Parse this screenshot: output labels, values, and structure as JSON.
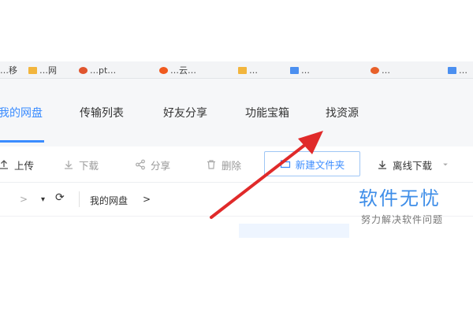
{
  "bookmarks": [
    {
      "label": "…移",
      "color": "#e7a23a"
    },
    {
      "label": "…网",
      "color": "#f2b53d"
    },
    {
      "label": "…pt…",
      "color": "#e0552e"
    },
    {
      "label": "…云…",
      "color": "#f05a1f"
    },
    {
      "label": "…",
      "color": "#f2b53d"
    },
    {
      "label": "…",
      "color": "#4b8ff0"
    },
    {
      "label": "…",
      "color": "#e8602a"
    },
    {
      "label": "…",
      "color": "#4b8ff0"
    }
  ],
  "tabs": [
    {
      "label": "我的网盘",
      "active": true
    },
    {
      "label": "传输列表",
      "active": false
    },
    {
      "label": "好友分享",
      "active": false
    },
    {
      "label": "功能宝箱",
      "active": false
    },
    {
      "label": "找资源",
      "active": false
    }
  ],
  "toolbar": {
    "upload": "上传",
    "download": "下载",
    "share": "分享",
    "delete": "删除",
    "new_folder": "新建文件夹",
    "offline_download": "离线下载"
  },
  "path": {
    "forward": ">",
    "dropdown": "▾",
    "refresh": "⟳",
    "current": "我的网盘",
    "trail_arrow": ">"
  },
  "watermark": {
    "title": "软件无忧",
    "subtitle": "努力解决软件问题"
  },
  "colors": {
    "accent": "#3b8cff",
    "arrow": "#e02a2a"
  }
}
